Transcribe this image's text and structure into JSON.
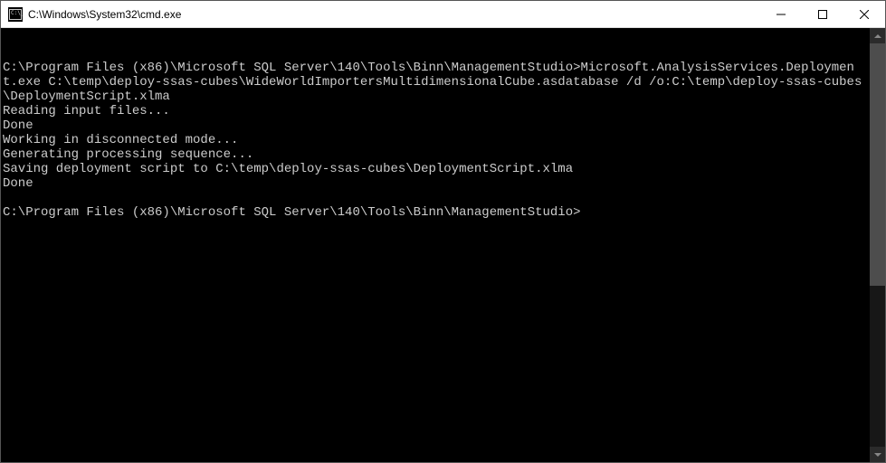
{
  "window": {
    "title": "C:\\Windows\\System32\\cmd.exe"
  },
  "terminal": {
    "line1": "C:\\Program Files (x86)\\Microsoft SQL Server\\140\\Tools\\Binn\\ManagementStudio>Microsoft.AnalysisServices.Deployment.exe C:\\temp\\deploy-ssas-cubes\\WideWorldImportersMultidimensionalCube.asdatabase /d /o:C:\\temp\\deploy-ssas-cubes\\DeploymentScript.xlma",
    "line2": "Reading input files...",
    "line3": "Done",
    "line4": "Working in disconnected mode...",
    "line5": "Generating processing sequence...",
    "line6": "Saving deployment script to C:\\temp\\deploy-ssas-cubes\\DeploymentScript.xlma",
    "line7": "Done",
    "line8": "",
    "prompt": "C:\\Program Files (x86)\\Microsoft SQL Server\\140\\Tools\\Binn\\ManagementStudio>"
  }
}
